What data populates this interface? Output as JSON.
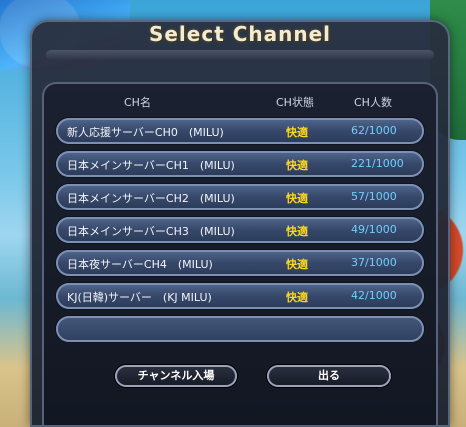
{
  "dialog": {
    "title": "Select Channel"
  },
  "columns": {
    "name": "CH名",
    "status": "CH状態",
    "users": "CH人数"
  },
  "channels": [
    {
      "name": "新人応援サーバーCH0　(MILU)",
      "status": "快適",
      "users": "62/1000"
    },
    {
      "name": "日本メインサーバーCH1　(MILU)",
      "status": "快適",
      "users": "221/1000"
    },
    {
      "name": "日本メインサーバーCH2　(MILU)",
      "status": "快適",
      "users": "57/1000"
    },
    {
      "name": "日本メインサーバーCH3　(MILU)",
      "status": "快適",
      "users": "49/1000"
    },
    {
      "name": "日本夜サーバーCH4　(MILU)",
      "status": "快適",
      "users": "37/1000"
    },
    {
      "name": "KJ(日韓)サーバー　(KJ MILU)",
      "status": "快適",
      "users": "42/1000"
    }
  ],
  "buttons": {
    "enter": "チャンネル入場",
    "exit": "出る"
  },
  "colors": {
    "status": "#ffd91a",
    "users": "#6fd0ff",
    "row": "#36486a"
  }
}
